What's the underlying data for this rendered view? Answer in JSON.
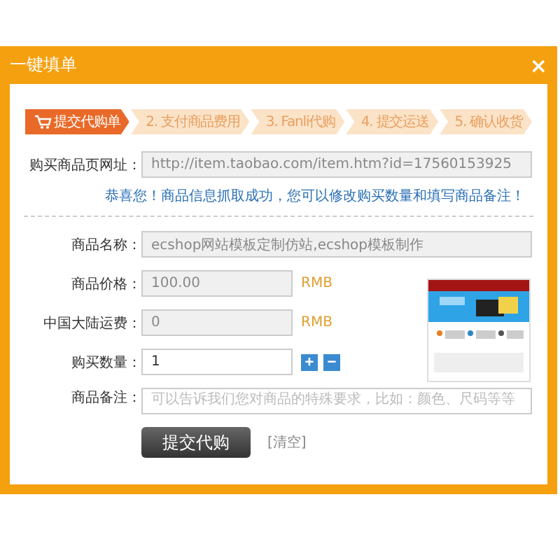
{
  "window": {
    "title": "一键填单",
    "close": "×"
  },
  "steps": [
    {
      "label": "提交代购单",
      "selected": true
    },
    {
      "label": "2. 支付商品费用",
      "selected": false
    },
    {
      "label": "3. Fanli代购",
      "selected": false
    },
    {
      "label": "4. 提交运送",
      "selected": false
    },
    {
      "label": "5. 确认收货",
      "selected": false
    }
  ],
  "url": {
    "label": "购买商品页网址：",
    "value": "http://item.taobao.com/item.htm?id=17560153925",
    "disabled": true
  },
  "message": "恭喜您！商品信息抓取成功，您可以修改购买数量和填写商品备注！",
  "name": {
    "label": "商品名称：",
    "value": "ecshop网站模板定制仿站,ecshop模板制作",
    "disabled": true
  },
  "price": {
    "label": "商品价格：",
    "value": "100.00",
    "unit": "RMB",
    "disabled": true
  },
  "freight": {
    "label": "中国大陆运费：",
    "value": "0",
    "unit": "RMB",
    "disabled": true
  },
  "quantity": {
    "label": "购买数量：",
    "value": "1",
    "disabled": false,
    "plus": "+",
    "minus": "−"
  },
  "notes": {
    "label": "商品备注：",
    "placeholder": "可以告诉我们您对商品的特殊要求，比如：颜色、尺码等等"
  },
  "submit": "提交代购",
  "clear": "[清空]"
}
